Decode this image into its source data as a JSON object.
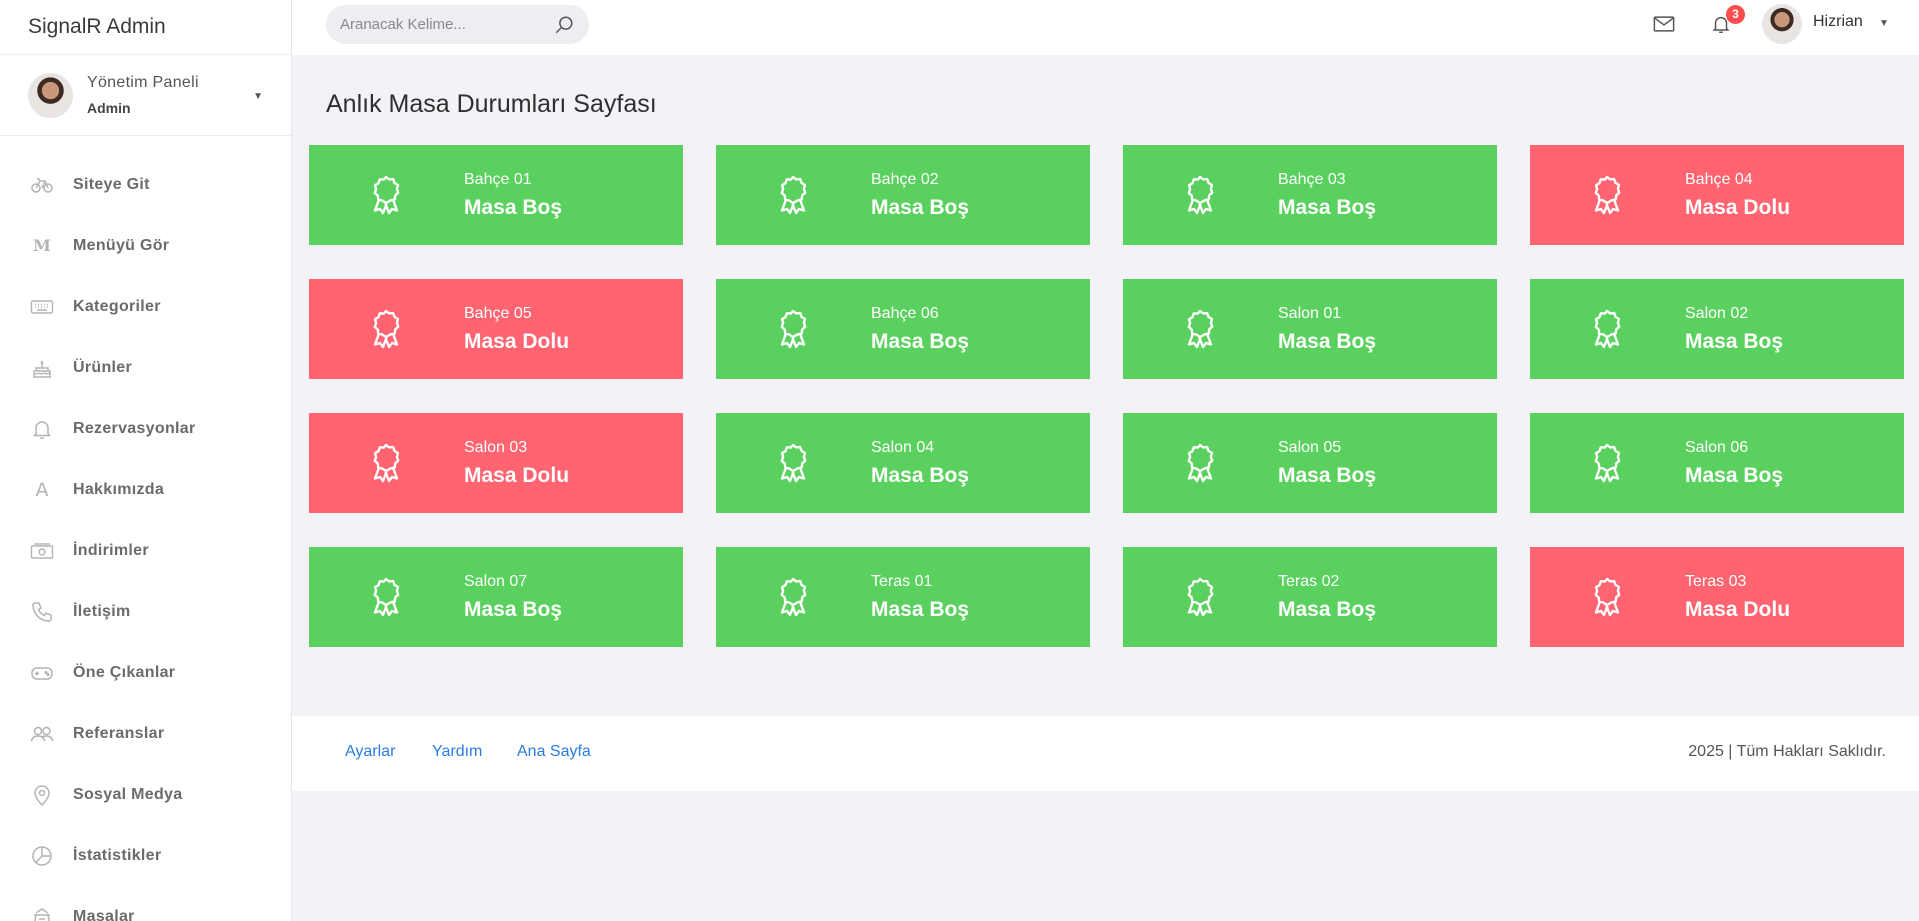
{
  "brand": "SignalR Admin",
  "profile": {
    "title": "Yönetim Paneli",
    "role": "Admin"
  },
  "sidebar": {
    "items": [
      {
        "label": "Siteye Git",
        "icon": "bicycle-icon"
      },
      {
        "label": "Menüyü Gör",
        "icon": "letter-m-icon"
      },
      {
        "label": "Kategoriler",
        "icon": "keyboard-icon"
      },
      {
        "label": "Ürünler",
        "icon": "cake-icon"
      },
      {
        "label": "Rezervasyonlar",
        "icon": "bell-icon"
      },
      {
        "label": "Hakkımızda",
        "icon": "letter-a-icon"
      },
      {
        "label": "İndirimler",
        "icon": "cash-icon"
      },
      {
        "label": "İletişim",
        "icon": "phone-icon"
      },
      {
        "label": "Öne Çıkanlar",
        "icon": "gamepad-icon"
      },
      {
        "label": "Referanslar",
        "icon": "users-icon"
      },
      {
        "label": "Sosyal Medya",
        "icon": "map-pin-icon"
      },
      {
        "label": "İstatistikler",
        "icon": "pie-chart-icon"
      },
      {
        "label": "Masalar",
        "icon": "table-icon"
      }
    ]
  },
  "search": {
    "placeholder": "Aranacak Kelime..."
  },
  "header": {
    "notification_count": "3",
    "user_name": "Hizrian"
  },
  "page_title": "Anlık Masa Durumları Sayfası",
  "tables": [
    {
      "name": "Bahçe 01",
      "status": "Masa Boş",
      "state": "free"
    },
    {
      "name": "Bahçe 02",
      "status": "Masa Boş",
      "state": "free"
    },
    {
      "name": "Bahçe 03",
      "status": "Masa Boş",
      "state": "free"
    },
    {
      "name": "Bahçe 04",
      "status": "Masa Dolu",
      "state": "full"
    },
    {
      "name": "Bahçe 05",
      "status": "Masa Dolu",
      "state": "full"
    },
    {
      "name": "Bahçe 06",
      "status": "Masa Boş",
      "state": "free"
    },
    {
      "name": "Salon 01",
      "status": "Masa Boş",
      "state": "free"
    },
    {
      "name": "Salon 02",
      "status": "Masa Boş",
      "state": "free"
    },
    {
      "name": "Salon 03",
      "status": "Masa Dolu",
      "state": "full"
    },
    {
      "name": "Salon 04",
      "status": "Masa Boş",
      "state": "free"
    },
    {
      "name": "Salon 05",
      "status": "Masa Boş",
      "state": "free"
    },
    {
      "name": "Salon 06",
      "status": "Masa Boş",
      "state": "free"
    },
    {
      "name": "Salon 07",
      "status": "Masa Boş",
      "state": "free"
    },
    {
      "name": "Teras 01",
      "status": "Masa Boş",
      "state": "free"
    },
    {
      "name": "Teras 02",
      "status": "Masa Boş",
      "state": "free"
    },
    {
      "name": "Teras 03",
      "status": "Masa Dolu",
      "state": "full"
    }
  ],
  "colors": {
    "free": "#5ad15e",
    "full": "#ff6470",
    "link": "#2a7de1"
  },
  "footer": {
    "links": [
      "Ayarlar",
      "Yardım",
      "Ana Sayfa"
    ],
    "copyright": "2025 | Tüm Hakları Saklıdır."
  }
}
